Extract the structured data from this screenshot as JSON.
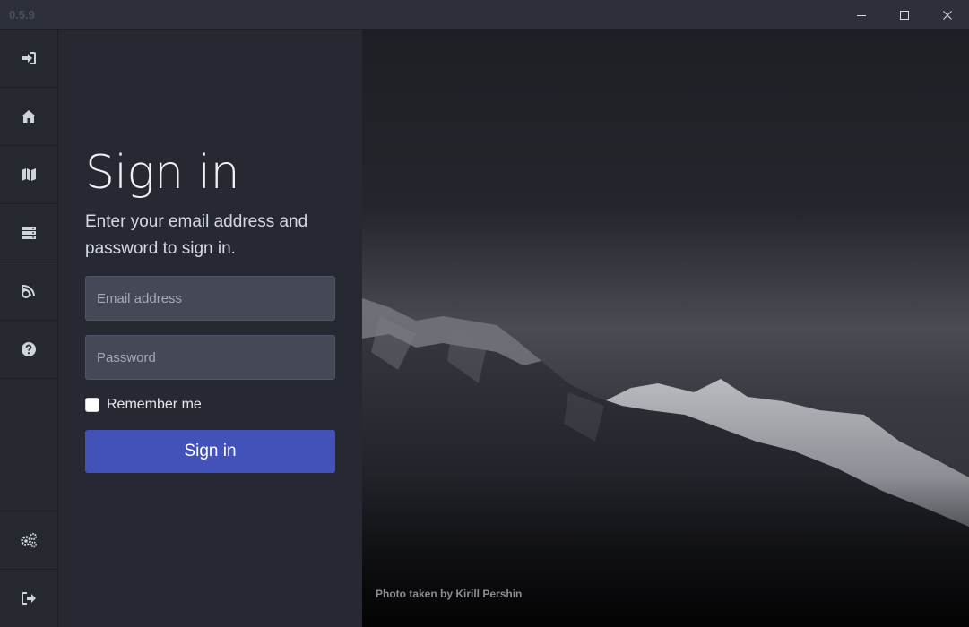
{
  "window": {
    "version": "0.5.9"
  },
  "sidebar": {
    "items": [
      {
        "icon": "sign-in-icon"
      },
      {
        "icon": "home-icon"
      },
      {
        "icon": "map-icon"
      },
      {
        "icon": "server-icon"
      },
      {
        "icon": "feed-icon"
      },
      {
        "icon": "help-icon"
      }
    ],
    "bottom_items": [
      {
        "icon": "settings-icon"
      },
      {
        "icon": "sign-out-icon"
      }
    ]
  },
  "signin": {
    "heading": "Sign in",
    "subtitle": "Enter your email address and password to sign in.",
    "email_placeholder": "Email address",
    "password_placeholder": "Password",
    "remember_label": "Remember me",
    "submit_label": "Sign in"
  },
  "photo": {
    "credit": "Photo taken by Kirill Pershin"
  },
  "colors": {
    "accent": "#4352b9",
    "panel": "#272932",
    "sidebar": "#262830",
    "input": "#444857"
  }
}
